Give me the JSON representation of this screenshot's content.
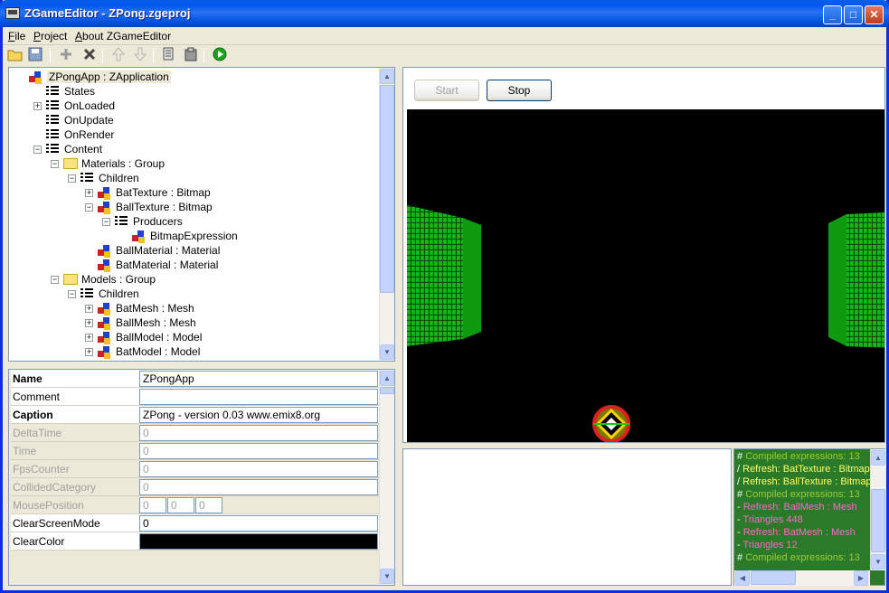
{
  "window": {
    "title": "ZGameEditor - ZPong.zgeproj"
  },
  "titlebar_buttons": [
    "_",
    "□",
    "✕"
  ],
  "menu": [
    {
      "label": "File",
      "key": "F",
      "rest": "ile"
    },
    {
      "label": "Project",
      "key": "P",
      "rest": "roject"
    },
    {
      "label": "About ZGameEditor",
      "key": "A",
      "rest": "bout ZGameEditor"
    }
  ],
  "tree": [
    {
      "label": "ZPongApp : ZApplication",
      "icon": "component-icon",
      "selected": true
    },
    {
      "label": "States",
      "icon": "list-icon"
    },
    {
      "label": "OnLoaded",
      "icon": "list-icon",
      "expander": "+"
    },
    {
      "label": "OnUpdate",
      "icon": "list-icon"
    },
    {
      "label": "OnRender",
      "icon": "list-icon"
    },
    {
      "label": "Content",
      "icon": "list-icon",
      "expander": "-"
    },
    {
      "label": "Materials : Group",
      "icon": "folder-icon",
      "expander": "-"
    },
    {
      "label": "Children",
      "icon": "list-icon",
      "expander": "-"
    },
    {
      "label": "BatTexture : Bitmap",
      "icon": "component-icon",
      "expander": "+"
    },
    {
      "label": "BallTexture : Bitmap",
      "icon": "component-icon",
      "expander": "-"
    },
    {
      "label": "Producers",
      "icon": "list-icon",
      "expander": "-"
    },
    {
      "label": "BitmapExpression",
      "icon": "component-icon"
    },
    {
      "label": "BallMaterial : Material",
      "icon": "component-icon"
    },
    {
      "label": "BatMaterial : Material",
      "icon": "component-icon"
    },
    {
      "label": "Models : Group",
      "icon": "folder-icon",
      "expander": "-"
    },
    {
      "label": "Children",
      "icon": "list-icon",
      "expander": "-"
    },
    {
      "label": "BatMesh : Mesh",
      "icon": "component-icon",
      "expander": "+"
    },
    {
      "label": "BallMesh : Mesh",
      "icon": "component-icon",
      "expander": "+"
    },
    {
      "label": "BallModel : Model",
      "icon": "component-icon",
      "expander": "+"
    },
    {
      "label": "BatModel : Model",
      "icon": "component-icon",
      "expander": "+"
    }
  ],
  "properties": [
    {
      "name": "Name",
      "value": "ZPongApp",
      "bold": true,
      "disabled": false
    },
    {
      "name": "Comment",
      "value": "",
      "bold": false,
      "disabled": false
    },
    {
      "name": "Caption",
      "value": "ZPong - version 0.03   www.emix8.org",
      "bold": true,
      "disabled": false
    },
    {
      "name": "DeltaTime",
      "value": "0",
      "bold": false,
      "disabled": true
    },
    {
      "name": "Time",
      "value": "0",
      "bold": false,
      "disabled": true
    },
    {
      "name": "FpsCounter",
      "value": "0",
      "bold": false,
      "disabled": true
    },
    {
      "name": "CollidedCategory",
      "value": "0",
      "bold": false,
      "disabled": true
    },
    {
      "name": "MousePosition",
      "values": [
        "0",
        "0",
        "0"
      ],
      "bold": false,
      "disabled": true
    },
    {
      "name": "ClearScreenMode",
      "value": "0",
      "bold": false,
      "disabled": false
    },
    {
      "name": "ClearColor",
      "value": "",
      "bold": false,
      "disabled": false,
      "color": "#000000"
    }
  ],
  "preview": {
    "start_label": "Start",
    "stop_label": "Stop"
  },
  "log": [
    {
      "prefix": "#",
      "text": "Compiled expressions: 13",
      "color": "#9acd32"
    },
    {
      "prefix": "/",
      "text": "Refresh: BatTexture : Bitmap",
      "color": "#ffff66"
    },
    {
      "prefix": "/",
      "text": "Refresh: BallTexture : Bitmap",
      "color": "#ffff66"
    },
    {
      "prefix": "#",
      "text": "Compiled expressions: 13",
      "color": "#9acd32"
    },
    {
      "prefix": "-",
      "text": "Refresh: BallMesh : Mesh",
      "color": "#ff66cc"
    },
    {
      "prefix": "-",
      "text": "Triangles 448",
      "color": "#ff66cc"
    },
    {
      "prefix": "-",
      "text": "Refresh: BatMesh : Mesh",
      "color": "#ff66cc"
    },
    {
      "prefix": "-",
      "text": "Triangles 12",
      "color": "#ff66cc"
    },
    {
      "prefix": "#",
      "text": "Compiled expressions: 13",
      "color": "#9acd32"
    }
  ],
  "colors": {
    "accent": "#0058ee",
    "log_bg": "#2a7a2a",
    "bat": "#19c319"
  }
}
